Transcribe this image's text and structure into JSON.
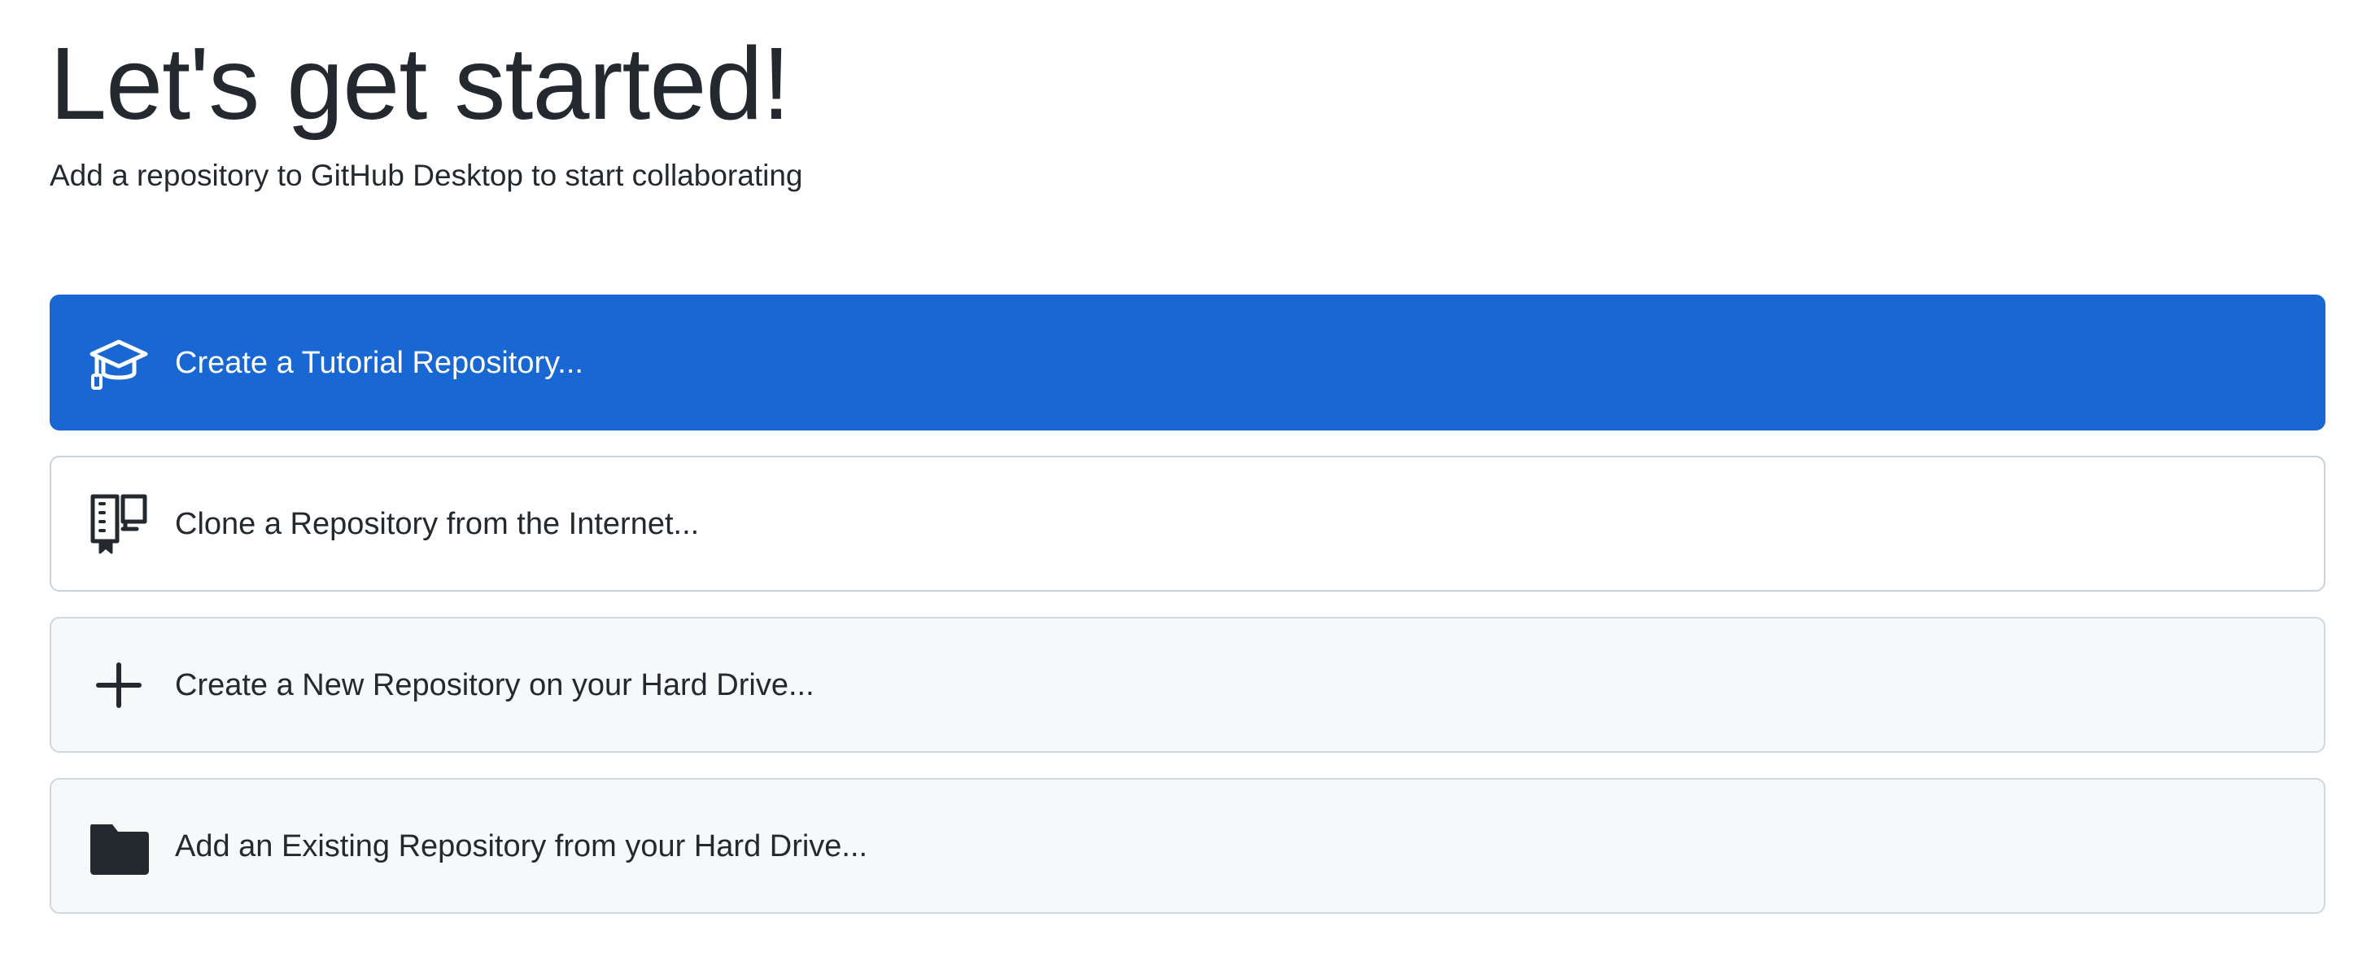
{
  "welcome": {
    "title": "Let's get started!",
    "subtitle": "Add a repository to GitHub Desktop to start collaborating"
  },
  "actions": [
    {
      "label": "Create a Tutorial Repository...",
      "icon": "mortarboard-icon",
      "style": "primary",
      "accent_color": "#1967d2"
    },
    {
      "label": "Clone a Repository from the Internet...",
      "icon": "repo-clone-icon",
      "style": "secondary"
    },
    {
      "label": "Create a New Repository on your Hard Drive...",
      "icon": "plus-icon",
      "style": "secondary"
    },
    {
      "label": "Add an Existing Repository from your Hard Drive...",
      "icon": "folder-icon",
      "style": "secondary"
    }
  ]
}
